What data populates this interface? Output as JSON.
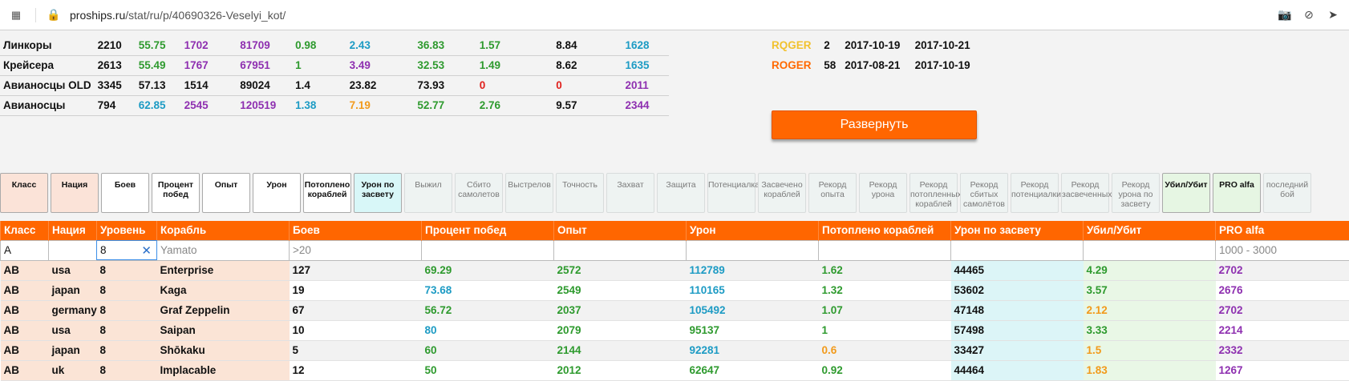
{
  "browser": {
    "url_domain": "proships.ru",
    "url_path": "/stat/ru/p/40690326-Veselyi_kot/"
  },
  "summary": [
    {
      "label": "Линкоры",
      "v": [
        "2210",
        "55.75",
        "1702",
        "81709",
        "0.98",
        "2.43",
        "36.83",
        "1.57",
        "8.84",
        "1628"
      ]
    },
    {
      "label": "Крейсера",
      "v": [
        "2613",
        "55.49",
        "1767",
        "67951",
        "1",
        "3.49",
        "32.53",
        "1.49",
        "8.62",
        "1635"
      ]
    },
    {
      "label": "Авианосцы OLD",
      "v": [
        "3345",
        "57.13",
        "1514",
        "89024",
        "1.4",
        "23.82",
        "73.93",
        "0",
        "0",
        "2011"
      ]
    },
    {
      "label": "Авианосцы",
      "v": [
        "794",
        "62.85",
        "2545",
        "120519",
        "1.38",
        "7.19",
        "52.77",
        "2.76",
        "9.57",
        "2344"
      ]
    }
  ],
  "rg": [
    {
      "nick": "RQGER",
      "count": "2",
      "from": "2017-10-19",
      "to": "2017-10-21"
    },
    {
      "nick": "ROGER",
      "count": "58",
      "from": "2017-08-21",
      "to": "2017-10-19"
    }
  ],
  "expand_label": "Развернуть",
  "toggles": [
    {
      "label": "Класс",
      "state": "on-pink"
    },
    {
      "label": "Нация",
      "state": "on-pink"
    },
    {
      "label": "Боев",
      "state": "on-white"
    },
    {
      "label": "Процент побед",
      "state": "on-white"
    },
    {
      "label": "Опыт",
      "state": "on-white"
    },
    {
      "label": "Урон",
      "state": "on-white"
    },
    {
      "label": "Потоплено кораблей",
      "state": "on-white"
    },
    {
      "label": "Урон по засвету",
      "state": "on-cyan"
    },
    {
      "label": "Выжил",
      "state": "off"
    },
    {
      "label": "Сбито самолетов",
      "state": "off"
    },
    {
      "label": "Выстрелов",
      "state": "off"
    },
    {
      "label": "Точность",
      "state": "off"
    },
    {
      "label": "Захват",
      "state": "off"
    },
    {
      "label": "Защита",
      "state": "off"
    },
    {
      "label": "Потенциалка",
      "state": "off"
    },
    {
      "label": "Засвечено кораблей",
      "state": "off"
    },
    {
      "label": "Рекорд опыта",
      "state": "off"
    },
    {
      "label": "Рекорд урона",
      "state": "off"
    },
    {
      "label": "Рекорд потопленных кораблей",
      "state": "off"
    },
    {
      "label": "Рекорд сбитых самолётов",
      "state": "off"
    },
    {
      "label": "Рекорд потенциалки",
      "state": "off"
    },
    {
      "label": "Рекорд засвеченных",
      "state": "off"
    },
    {
      "label": "Рекорд урона по засвету",
      "state": "off"
    },
    {
      "label": "Убил/Убит",
      "state": "on-green"
    },
    {
      "label": "PRO alfa",
      "state": "on-green"
    },
    {
      "label": "последний бой",
      "state": "off"
    }
  ],
  "table": {
    "headers": [
      "Класс",
      "Нация",
      "Уровень",
      "Корабль",
      "Боев",
      "Процент побед",
      "Опыт",
      "Урон",
      "Потоплено кораблей",
      "Урон по засвету",
      "Убил/Убит",
      "PRO alfa"
    ],
    "filters": {
      "class_value": "A",
      "level_value": "8",
      "ship_placeholder": "Yamato",
      "battles_placeholder": ">20",
      "pro_placeholder": "1000 - 3000"
    },
    "rows": [
      [
        "AB",
        "usa",
        "8",
        "Enterprise",
        "127",
        "69.29",
        "2572",
        "112789",
        "1.62",
        "44465",
        "4.29",
        "2702"
      ],
      [
        "AB",
        "japan",
        "8",
        "Kaga",
        "19",
        "73.68",
        "2549",
        "110165",
        "1.32",
        "53602",
        "3.57",
        "2676"
      ],
      [
        "AB",
        "germany",
        "8",
        "Graf Zeppelin",
        "67",
        "56.72",
        "2037",
        "105492",
        "1.07",
        "47148",
        "2.12",
        "2702"
      ],
      [
        "AB",
        "usa",
        "8",
        "Saipan",
        "10",
        "80",
        "2079",
        "95137",
        "1",
        "57498",
        "3.33",
        "2214"
      ],
      [
        "AB",
        "japan",
        "8",
        "Shōkaku",
        "5",
        "60",
        "2144",
        "92281",
        "0.6",
        "33427",
        "1.5",
        "2332"
      ],
      [
        "AB",
        "uk",
        "8",
        "Implacable",
        "12",
        "50",
        "2012",
        "62647",
        "0.92",
        "44464",
        "1.83",
        "1267"
      ]
    ]
  },
  "colors": {
    "accent": "#ff6600",
    "green": "#2e9a2e",
    "purple": "#8e2fb0",
    "teal": "#1d9bc4",
    "red": "#e0201c",
    "orange": "#f29a1b"
  }
}
